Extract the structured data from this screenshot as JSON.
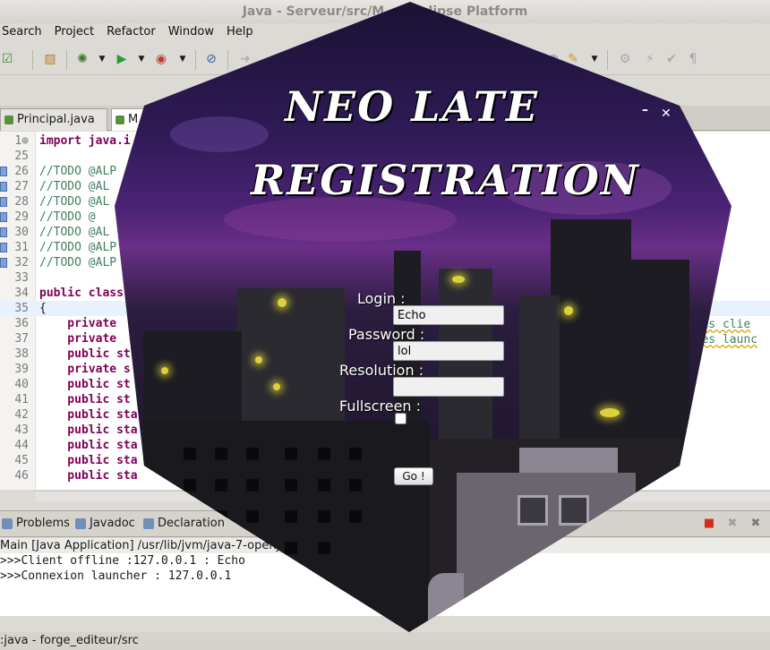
{
  "window_title": "Java - Serveur/src/M...  - Eclipse Platform",
  "menu": [
    "Search",
    "Project",
    "Refactor",
    "Window",
    "Help"
  ],
  "editor_tabs": [
    {
      "label": "Principal.java"
    },
    {
      "label": "M"
    }
  ],
  "code_lines": [
    {
      "num": "1⊕",
      "text": "import java.i",
      "kind": "import"
    },
    {
      "num": "25",
      "text": "",
      "kind": "plain"
    },
    {
      "num": "26",
      "text": "//TODO @ALP",
      "kind": "comment"
    },
    {
      "num": "27",
      "text": "//TODO @AL",
      "kind": "comment"
    },
    {
      "num": "28",
      "text": "//TODO @AL",
      "kind": "comment"
    },
    {
      "num": "29",
      "text": "//TODO @",
      "kind": "comment"
    },
    {
      "num": "30",
      "text": "//TODO @AL",
      "kind": "comment"
    },
    {
      "num": "31",
      "text": "//TODO @ALP",
      "kind": "comment"
    },
    {
      "num": "32",
      "text": "//TODO @ALP",
      "kind": "comment"
    },
    {
      "num": "33",
      "text": "",
      "kind": "plain"
    },
    {
      "num": "34",
      "text": "public class",
      "kind": "keyword"
    },
    {
      "num": "35",
      "text": "{",
      "kind": "plain"
    },
    {
      "num": "36",
      "text": "    private",
      "kind": "keyword"
    },
    {
      "num": "37",
      "text": "    private",
      "kind": "keyword"
    },
    {
      "num": "38",
      "text": "    public st",
      "kind": "keyword"
    },
    {
      "num": "39",
      "text": "    private s",
      "kind": "keyword"
    },
    {
      "num": "40",
      "text": "    public st",
      "kind": "keyword"
    },
    {
      "num": "41",
      "text": "    public st",
      "kind": "keyword"
    },
    {
      "num": "42",
      "text": "    public sta",
      "kind": "keyword"
    },
    {
      "num": "43",
      "text": "    public sta",
      "kind": "keyword"
    },
    {
      "num": "44",
      "text": "    public sta",
      "kind": "keyword"
    },
    {
      "num": "45",
      "text": "    public sta",
      "kind": "keyword"
    },
    {
      "num": "46",
      "text": "    public sta",
      "kind": "keyword"
    }
  ],
  "right_fragments": [
    "s les clie",
    "s les launc"
  ],
  "console_tabs": [
    "Problems",
    "Javadoc",
    "Declaration"
  ],
  "console_info": "Main [Java Application] /usr/lib/jvm/java-7-openj",
  "console_lines": [
    ">>>Client offline :127.0.0.1 : Echo",
    ">>>Connexion launcher : 127.0.0.1"
  ],
  "status_text": ":java - forge_editeur/src",
  "launcher": {
    "title_line1": "NEO LATE",
    "title_line2": "REGISTRATION",
    "minimize_label": "–",
    "close_label": "✕",
    "login_label": "Login :",
    "login_value": "Echo",
    "password_label": "Password :",
    "password_value": "lol",
    "resolution_label": "Resolution :",
    "resolution_value": "",
    "fullscreen_label": "Fullscreen :",
    "go_label": "Go !"
  }
}
